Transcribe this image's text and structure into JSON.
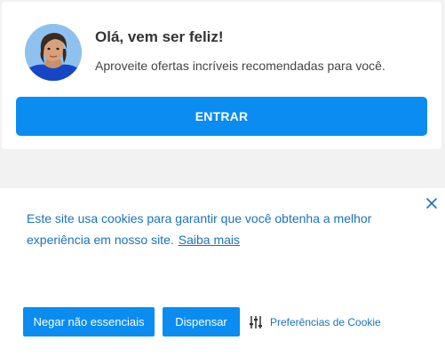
{
  "welcome": {
    "title": "Olá, vem ser feliz!",
    "subtitle": "Aproveite ofertas incríveis recomendadas para você.",
    "login_label": "ENTRAR",
    "accent": "#0a8cf1"
  },
  "cookie": {
    "text": "Este site usa cookies para garantir que você obtenha a melhor experiência em nosso site.",
    "learn_more": "Saiba mais",
    "deny_label": "Negar não essenciais",
    "dismiss_label": "Dispensar",
    "preferences_label": "Preferências de Cookie",
    "close_icon": "close-icon",
    "preferences_icon": "sliders-icon",
    "text_color": "#1a73b8"
  }
}
